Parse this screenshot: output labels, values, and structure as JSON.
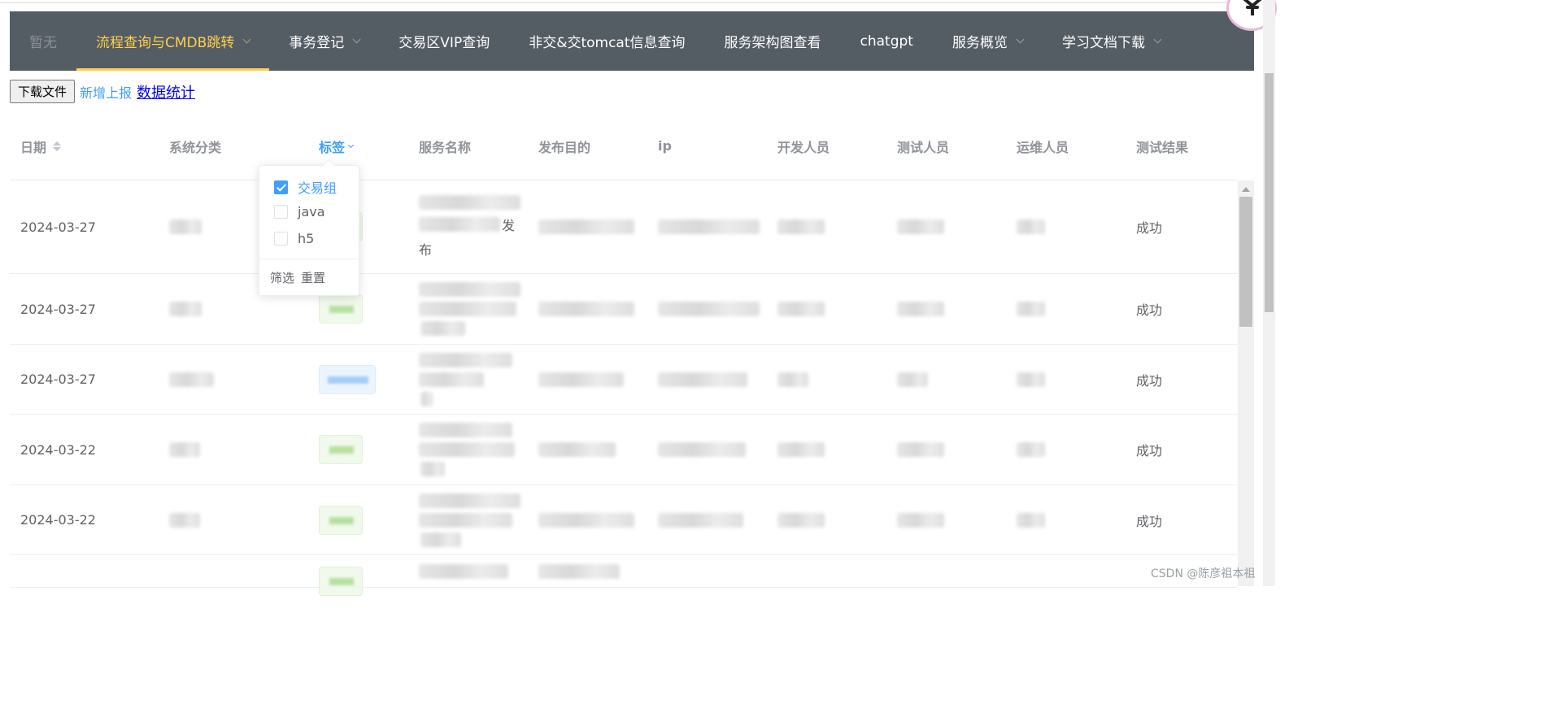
{
  "nav": {
    "items": [
      {
        "label": "暂无",
        "state": "disabled",
        "caret": false
      },
      {
        "label": "流程查询与CMDB跳转",
        "state": "active",
        "caret": true
      },
      {
        "label": "事务登记",
        "state": "normal",
        "caret": true
      },
      {
        "label": "交易区VIP查询",
        "state": "normal",
        "caret": false
      },
      {
        "label": "非交&交tomcat信息查询",
        "state": "normal",
        "caret": false
      },
      {
        "label": "服务架构图查看",
        "state": "normal",
        "caret": false
      },
      {
        "label": "chatgpt",
        "state": "normal",
        "caret": false
      },
      {
        "label": "服务概览",
        "state": "normal",
        "caret": true
      },
      {
        "label": "学习文档下载",
        "state": "normal",
        "caret": true
      }
    ],
    "colors": {
      "background": "#545c64",
      "active": "#ffd04b"
    }
  },
  "actions": {
    "download_label": "下载文件",
    "new_report_label": "新增上报",
    "stats_label": "数据统计"
  },
  "table": {
    "columns": [
      "日期",
      "系统分类",
      "标签",
      "服务名称",
      "发布目的",
      "ip",
      "开发人员",
      "测试人员",
      "运维人员",
      "测试结果"
    ],
    "rows": [
      {
        "date": "2024-03-27",
        "service_suffix": "发",
        "service_line2": "布",
        "result": "成功"
      },
      {
        "date": "2024-03-27",
        "service_suffix": "",
        "service_line2": "",
        "result": "成功"
      },
      {
        "date": "2024-03-27",
        "service_suffix": "",
        "service_line2": "",
        "result": "成功"
      },
      {
        "date": "2024-03-22",
        "service_suffix": "",
        "service_line2": "",
        "result": "成功"
      },
      {
        "date": "2024-03-22",
        "service_suffix": "",
        "service_line2": "",
        "result": "成功"
      }
    ]
  },
  "filter_popup": {
    "options": [
      {
        "label": "交易组",
        "checked": true
      },
      {
        "label": "java",
        "checked": false
      },
      {
        "label": "h5",
        "checked": false
      }
    ],
    "confirm_label": "筛选",
    "reset_label": "重置"
  },
  "watermark": "CSDN @陈彦祖本祖",
  "colors": {
    "primary": "#409eff",
    "text": "#606266",
    "header_text": "#909399"
  }
}
